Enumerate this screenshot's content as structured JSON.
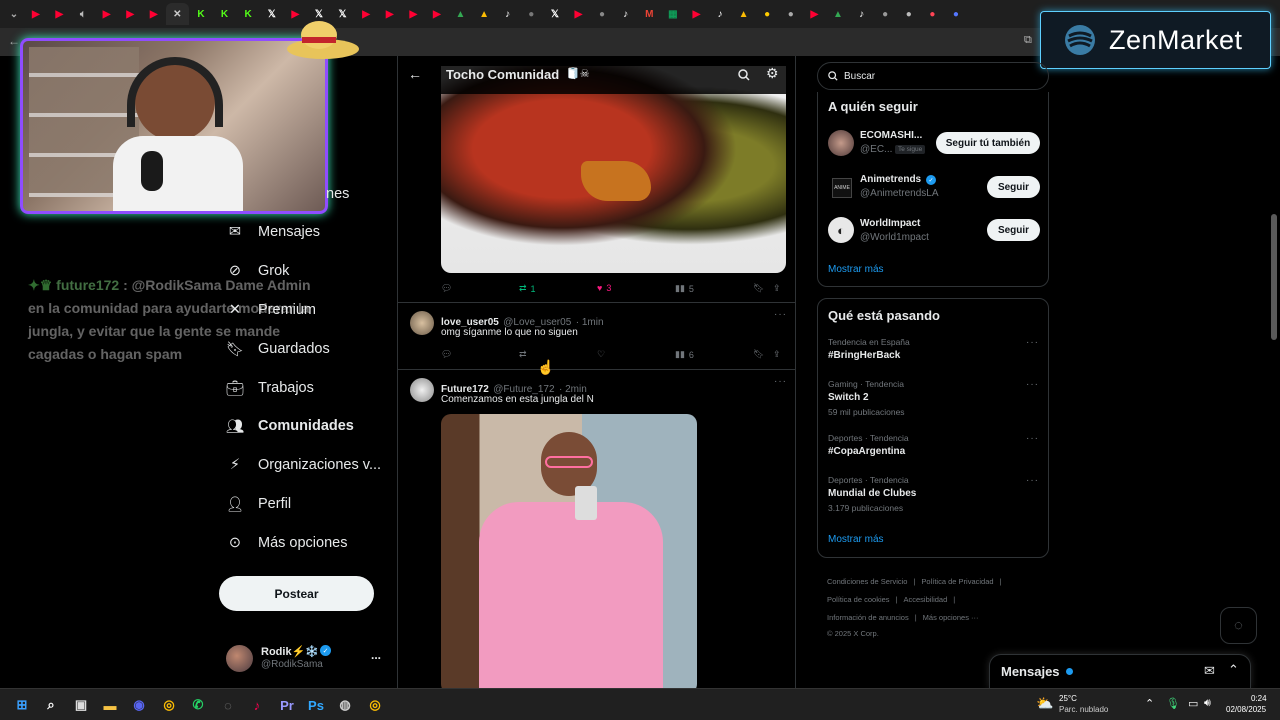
{
  "tabs": [
    {
      "icon": "youtube-icon",
      "color": "#ff0033"
    },
    {
      "icon": "youtube-icon",
      "color": "#ff0033"
    },
    {
      "icon": "speaker-icon",
      "color": "#bbbbbb"
    },
    {
      "icon": "youtube-icon",
      "color": "#ff0033"
    },
    {
      "icon": "youtube-icon",
      "color": "#ff0033"
    },
    {
      "icon": "youtube-icon",
      "color": "#ff0033"
    },
    {
      "icon": "close-icon",
      "color": "#cccccc",
      "active": true
    },
    {
      "icon": "kick-icon",
      "color": "#53fc18"
    },
    {
      "icon": "kick-icon",
      "color": "#53fc18"
    },
    {
      "icon": "kick-icon",
      "color": "#53fc18"
    },
    {
      "icon": "x-icon",
      "color": "#ffffff"
    },
    {
      "icon": "youtube-icon",
      "color": "#ff0033"
    },
    {
      "icon": "x-icon",
      "color": "#ffffff"
    },
    {
      "icon": "x-icon",
      "color": "#ffffff"
    },
    {
      "icon": "youtube-icon",
      "color": "#ff0033"
    },
    {
      "icon": "youtube-icon",
      "color": "#ff0033"
    },
    {
      "icon": "youtube-icon",
      "color": "#ff0033"
    },
    {
      "icon": "youtube-icon",
      "color": "#ff0033"
    },
    {
      "icon": "drive-icon",
      "color": "#34a853"
    },
    {
      "icon": "drive-icon",
      "color": "#fbbc04"
    },
    {
      "icon": "tiktok-icon",
      "color": "#ffffff"
    },
    {
      "icon": "generic-icon",
      "color": "#777777"
    },
    {
      "icon": "x-icon",
      "color": "#ffffff"
    },
    {
      "icon": "youtube-icon",
      "color": "#ff0033"
    },
    {
      "icon": "generic-icon",
      "color": "#888888"
    },
    {
      "icon": "tiktok-icon",
      "color": "#ffffff"
    },
    {
      "icon": "gmail-icon",
      "color": "#ea4335"
    },
    {
      "icon": "sheets-icon",
      "color": "#0f9d58"
    },
    {
      "icon": "youtube-icon",
      "color": "#ff0033"
    },
    {
      "icon": "tiktok-icon",
      "color": "#ffffff"
    },
    {
      "icon": "drive-icon",
      "color": "#fbbc04"
    },
    {
      "icon": "generic-icon",
      "color": "#ffcc00"
    },
    {
      "icon": "generic-icon",
      "color": "#aaaaaa"
    },
    {
      "icon": "youtube-icon",
      "color": "#ff0033"
    },
    {
      "icon": "drive-icon",
      "color": "#34a853"
    },
    {
      "icon": "tiktok-icon",
      "color": "#ffffff"
    },
    {
      "icon": "generic-icon",
      "color": "#999999"
    },
    {
      "icon": "generic-icon",
      "color": "#bbbbbb"
    },
    {
      "icon": "generic-icon",
      "color": "#ff4455"
    },
    {
      "icon": "generic-icon",
      "color": "#5577ff"
    }
  ],
  "brand": {
    "name": "ZenMarket",
    "accent": "#5ed0ff"
  },
  "overlay_chat": {
    "user": "future172",
    "message_prefix": ": @RodikSama Dame",
    "message_rest": "Admin en la comunidad para ayudarte moderar la jungla, y evitar que la gente se mande cagadas o hagan spam"
  },
  "nav": {
    "partial_label": "nes",
    "items": [
      {
        "label": "Mensajes",
        "icon": "mail-icon"
      },
      {
        "label": "Grok",
        "icon": "grok-icon"
      },
      {
        "label": "Premium",
        "icon": "x-icon"
      },
      {
        "label": "Guardados",
        "icon": "bookmark-icon"
      },
      {
        "label": "Trabajos",
        "icon": "briefcase-icon"
      },
      {
        "label": "Comunidades",
        "icon": "communities-icon",
        "active": true
      },
      {
        "label": "Organizaciones v...",
        "icon": "lightning-icon"
      },
      {
        "label": "Perfil",
        "icon": "person-icon"
      },
      {
        "label": "Más opciones",
        "icon": "more-circle-icon"
      }
    ],
    "post_button": "Postear",
    "account": {
      "name": "Rodik⚡❄️",
      "handle": "@RodikSama",
      "more": "..."
    }
  },
  "feed": {
    "title": "Tocho Comunidad",
    "title_emoji": "🧻☠",
    "first_actions": {
      "reposts": "1",
      "likes": "3",
      "views": "5"
    },
    "tweets": [
      {
        "name": "love_user05",
        "handle": "@Love_user05",
        "time": "· 1min",
        "text": "omg síganme lo que no siguen",
        "views": "6"
      },
      {
        "name": "Future172",
        "handle": "@Future_172",
        "time": "· 2min",
        "text": "Comenzamos en esta jungla del N"
      }
    ]
  },
  "search": {
    "placeholder": "Buscar"
  },
  "who_to_follow": {
    "title": "A quién seguir",
    "accounts": [
      {
        "name": "ECOMASHI...",
        "handle": "@EC...",
        "badge": "Te sigue",
        "button": "Seguir tú también"
      },
      {
        "name": "Animetrends",
        "handle": "@AnimetrendsLA",
        "button": "Seguir",
        "verified": true
      },
      {
        "name": "WorldImpact",
        "handle": "@World1mpact",
        "button": "Seguir"
      }
    ],
    "more": "Mostrar más"
  },
  "trends": {
    "title": "Qué está pasando",
    "items": [
      {
        "category": "Tendencia en España",
        "title": "#BringHerBack",
        "count": ""
      },
      {
        "category": "Gaming · Tendencia",
        "title": "Switch 2",
        "count": "59 mil publicaciones"
      },
      {
        "category": "Deportes · Tendencia",
        "title": "#CopaArgentina",
        "count": ""
      },
      {
        "category": "Deportes · Tendencia",
        "title": "Mundial de Clubes",
        "count": "3.179 publicaciones"
      }
    ],
    "more": "Mostrar más"
  },
  "footer": {
    "line1": [
      "Condiciones de Servicio",
      "|",
      "Política de Privacidad",
      "|"
    ],
    "line2": [
      "Política de cookies",
      "|",
      "Accesibilidad",
      "|"
    ],
    "line3": [
      "Información de anuncios",
      "|",
      "Más opciones ···"
    ],
    "copyright": "© 2025 X Corp."
  },
  "messages_drawer": {
    "title": "Mensajes"
  },
  "taskbar": {
    "weather_temp": "25°C",
    "weather_desc": "Parc. nublado",
    "time": "0:24",
    "date": "02/08/2025",
    "apps": [
      {
        "icon": "windows-start-icon",
        "color": "#3aa0ff"
      },
      {
        "icon": "search-icon",
        "color": "#ffffff"
      },
      {
        "icon": "task-view-icon",
        "color": "#dddddd"
      },
      {
        "icon": "file-explorer-icon",
        "color": "#f6c344"
      },
      {
        "icon": "discord-icon",
        "color": "#5865f2"
      },
      {
        "icon": "chrome-icon",
        "color": "#fbbc04"
      },
      {
        "icon": "whatsapp-icon",
        "color": "#25d366"
      },
      {
        "icon": "app-icon",
        "color": "#888888"
      },
      {
        "icon": "tiktok-icon",
        "color": "#ff0050"
      },
      {
        "icon": "premiere-icon",
        "color": "#9999ff"
      },
      {
        "icon": "photoshop-icon",
        "color": "#31a8ff"
      },
      {
        "icon": "obs-icon",
        "color": "#cccccc"
      },
      {
        "icon": "chrome-icon",
        "color": "#fbbc04"
      }
    ]
  }
}
